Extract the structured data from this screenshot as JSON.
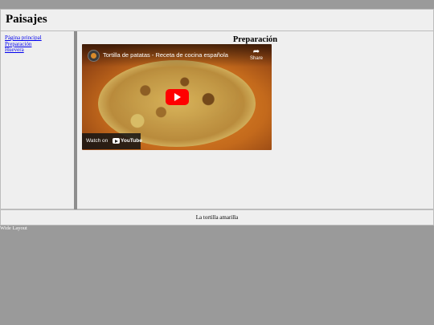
{
  "header": {
    "title": "Paisajes"
  },
  "sidebar": {
    "links": [
      {
        "label": "Página principal"
      },
      {
        "label": "Preparación"
      },
      {
        "label": "Huevera"
      }
    ]
  },
  "main": {
    "heading": "Preparación",
    "video": {
      "title": "Tortilla de patatas - Receta de cocina española",
      "share_label": "Share",
      "watch_on": "Watch on",
      "youtube_label": "YouTube",
      "share_icon": "share-arrow-icon",
      "play_icon": "play-icon"
    }
  },
  "footer": {
    "text": "La tortilla amarilla"
  },
  "layout_link": {
    "label": "Wide Layout"
  },
  "colors": {
    "page_background": "#9a9a9a",
    "panel_background": "#efefef",
    "link": "#0000ee",
    "play_button": "#ff0000"
  }
}
